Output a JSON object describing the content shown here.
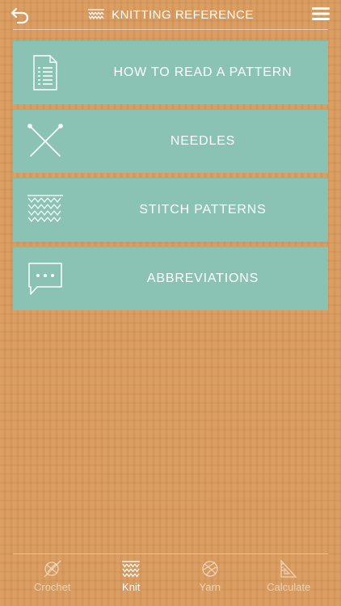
{
  "header": {
    "title": "KNITTING REFERENCE",
    "back_icon": "back-arrow-icon",
    "menu_icon": "hamburger-menu-icon"
  },
  "menu": {
    "items": [
      {
        "label": "HOW TO READ A PATTERN",
        "icon": "document-icon"
      },
      {
        "label": "NEEDLES",
        "icon": "crossed-needles-icon"
      },
      {
        "label": "STITCH PATTERNS",
        "icon": "stitch-icon"
      },
      {
        "label": "ABBREVIATIONS",
        "icon": "speech-bubble-icon"
      }
    ]
  },
  "tabs": [
    {
      "label": "Crochet",
      "icon": "crochet-icon",
      "active": false
    },
    {
      "label": "Knit",
      "icon": "knit-icon",
      "active": true
    },
    {
      "label": "Yarn",
      "icon": "yarn-ball-icon",
      "active": false
    },
    {
      "label": "Calculate",
      "icon": "calculator-icon",
      "active": false
    }
  ],
  "colors": {
    "background": "#d99a5c",
    "card": "#8ac3b4",
    "text": "#ffffff"
  }
}
